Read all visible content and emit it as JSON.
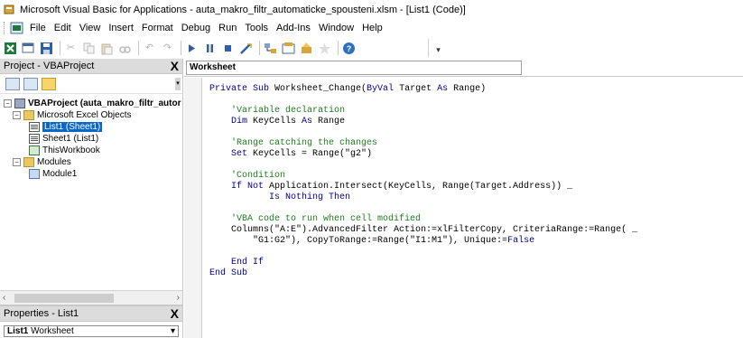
{
  "window": {
    "title": "Microsoft Visual Basic for Applications - auta_makro_filtr_automaticke_spousteni.xlsm - [List1 (Code)]"
  },
  "menu": [
    {
      "label": "File"
    },
    {
      "label": "Edit"
    },
    {
      "label": "View"
    },
    {
      "label": "Insert"
    },
    {
      "label": "Format"
    },
    {
      "label": "Debug"
    },
    {
      "label": "Run"
    },
    {
      "label": "Tools"
    },
    {
      "label": "Add-Ins"
    },
    {
      "label": "Window"
    },
    {
      "label": "Help"
    }
  ],
  "project_panel": {
    "title": "Project - VBAProject",
    "close": "X",
    "tree": {
      "root": "VBAProject (auta_makro_filtr_autor",
      "excel_objects": "Microsoft Excel Objects",
      "list1": "List1 (Sheet1)",
      "sheet1": "Sheet1 (List1)",
      "thisworkbook": "ThisWorkbook",
      "modules": "Modules",
      "module1": "Module1"
    }
  },
  "properties_panel": {
    "title": "Properties - List1",
    "close": "X",
    "object_name": "List1",
    "object_type": "Worksheet"
  },
  "editor": {
    "object_combo": "Worksheet",
    "lines": [
      [
        {
          "t": "kw",
          "v": "Private Sub "
        },
        {
          "t": "tx",
          "v": "Worksheet_Change("
        },
        {
          "t": "kw",
          "v": "ByVal "
        },
        {
          "t": "tx",
          "v": "Target "
        },
        {
          "t": "kw",
          "v": "As "
        },
        {
          "t": "tx",
          "v": "Range)"
        }
      ],
      [],
      [
        {
          "t": "cm",
          "v": "    'Variable declaration"
        }
      ],
      [
        {
          "t": "kw",
          "v": "    Dim "
        },
        {
          "t": "tx",
          "v": "KeyCells "
        },
        {
          "t": "kw",
          "v": "As "
        },
        {
          "t": "tx",
          "v": "Range"
        }
      ],
      [],
      [
        {
          "t": "cm",
          "v": "    'Range catching the changes"
        }
      ],
      [
        {
          "t": "kw",
          "v": "    Set "
        },
        {
          "t": "tx",
          "v": "KeyCells = Range(\"g2\")"
        }
      ],
      [],
      [
        {
          "t": "cm",
          "v": "    'Condition"
        }
      ],
      [
        {
          "t": "kw",
          "v": "    If Not "
        },
        {
          "t": "tx",
          "v": "Application.Intersect(KeyCells, Range(Target.Address)) _"
        }
      ],
      [
        {
          "t": "kw",
          "v": "           Is Nothing Then"
        }
      ],
      [],
      [
        {
          "t": "cm",
          "v": "    'VBA code to run when cell modified"
        }
      ],
      [
        {
          "t": "tx",
          "v": "    Columns(\"A:E\").AdvancedFilter Action:=xlFilterCopy, CriteriaRange:=Range( _"
        }
      ],
      [
        {
          "t": "tx",
          "v": "        \"G1:G2\"), CopyToRange:=Range(\"I1:M1\"), Unique:="
        },
        {
          "t": "kw",
          "v": "False"
        }
      ],
      [],
      [
        {
          "t": "kw",
          "v": "    End If"
        }
      ],
      [
        {
          "t": "kw",
          "v": "End Sub"
        }
      ]
    ]
  },
  "colors": {
    "keyword": "#00008b",
    "comment": "#1f7a1f",
    "selection": "#0b67c7"
  },
  "icons": [
    "vba-app-icon",
    "excel-view-icon",
    "insert-form-icon",
    "save-icon",
    "cut-icon",
    "copy-icon",
    "paste-icon",
    "find-icon",
    "undo-icon",
    "redo-icon",
    "run-icon",
    "break-icon",
    "reset-icon",
    "design-mode-icon",
    "project-explorer-icon",
    "properties-window-icon",
    "object-browser-icon",
    "toolbox-icon",
    "help-icon"
  ]
}
